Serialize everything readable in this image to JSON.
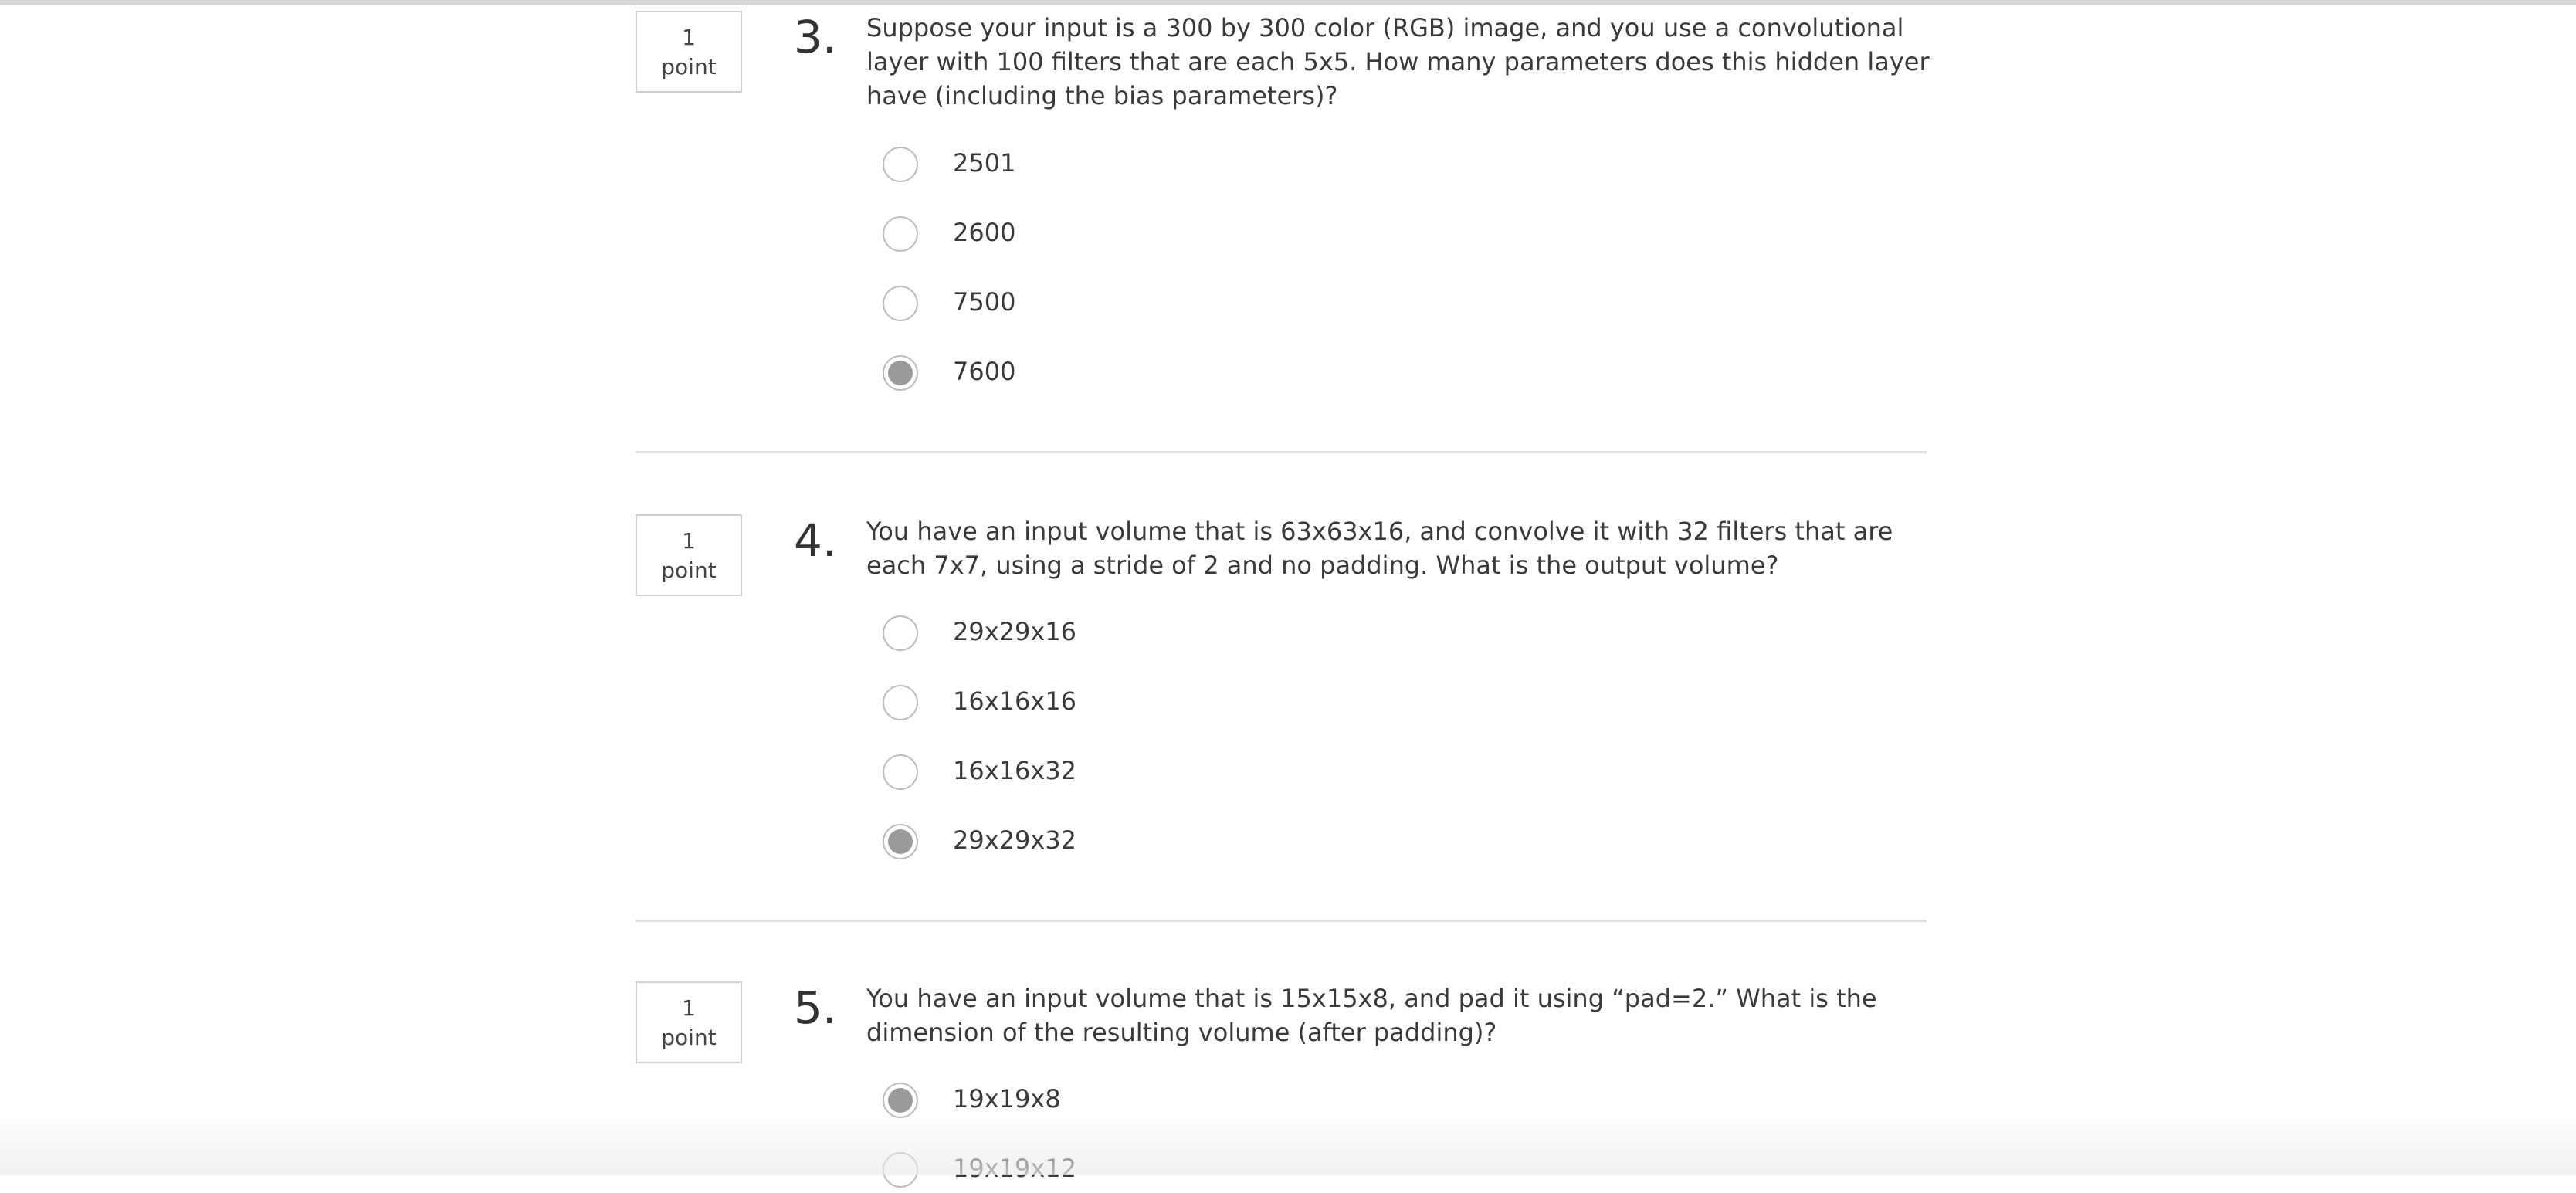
{
  "questions": [
    {
      "points_value": "1",
      "points_label": "point",
      "number": "3.",
      "prompt": "Suppose your input is a 300 by 300 color (RGB) image, and you use a convolutional layer with 100 filters that are each 5x5. How many parameters does this hidden layer have (including the bias parameters)?",
      "options": [
        {
          "label": "2501",
          "selected": false
        },
        {
          "label": "2600",
          "selected": false
        },
        {
          "label": "7500",
          "selected": false
        },
        {
          "label": "7600",
          "selected": true
        }
      ]
    },
    {
      "points_value": "1",
      "points_label": "point",
      "number": "4.",
      "prompt": "You have an input volume that is 63x63x16, and convolve it with 32 filters that are each 7x7, using a stride of 2 and no padding. What is the output volume?",
      "options": [
        {
          "label": "29x29x16",
          "selected": false
        },
        {
          "label": "16x16x16",
          "selected": false
        },
        {
          "label": "16x16x32",
          "selected": false
        },
        {
          "label": "29x29x32",
          "selected": true
        }
      ]
    },
    {
      "points_value": "1",
      "points_label": "point",
      "number": "5.",
      "prompt": "You have an input volume that is 15x15x8, and pad it using “pad=2.” What is the dimension of the resulting volume (after padding)?",
      "options": [
        {
          "label": "19x19x8",
          "selected": true
        },
        {
          "label": "19x19x12",
          "selected": false
        }
      ]
    }
  ],
  "colors": {
    "radio_border": "#bdbdbd",
    "radio_fill": "#9a9a9a",
    "divider": "#dedede",
    "text": "#3a3a3a"
  }
}
